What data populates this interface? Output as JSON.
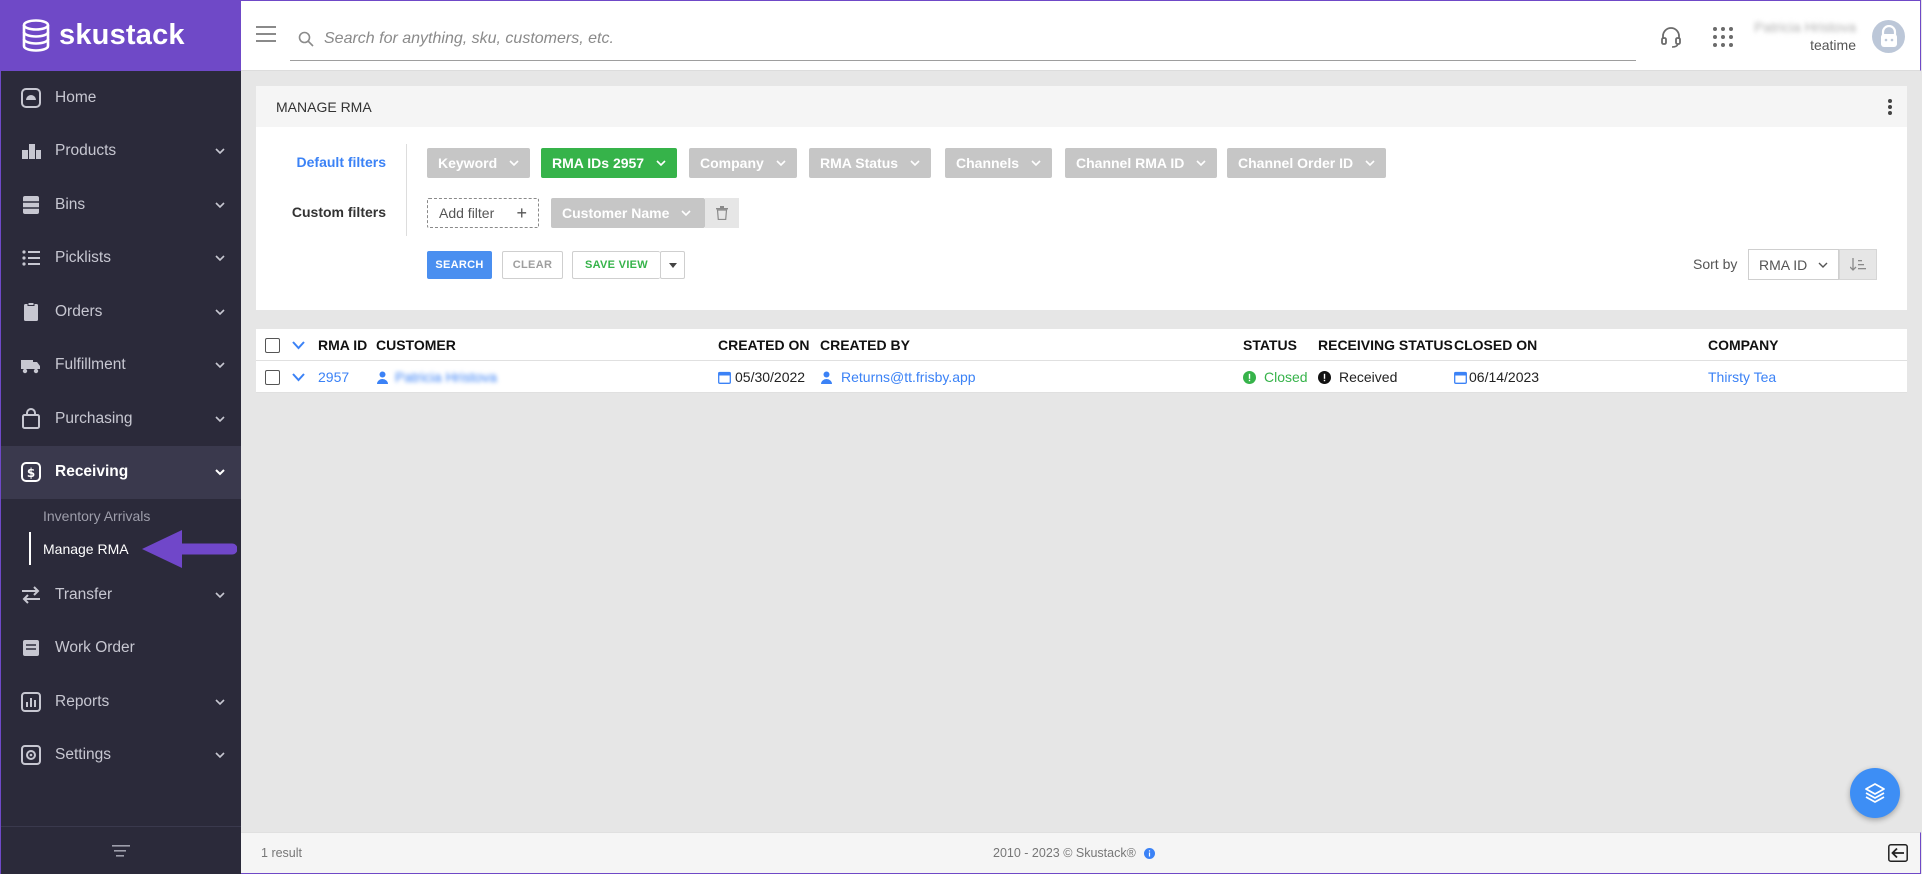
{
  "brand": {
    "name": "skustack"
  },
  "sidebar": {
    "items": [
      {
        "label": "Home",
        "icon": "home-icon"
      },
      {
        "label": "Products",
        "icon": "products-icon"
      },
      {
        "label": "Bins",
        "icon": "bins-icon"
      },
      {
        "label": "Picklists",
        "icon": "picklists-icon"
      },
      {
        "label": "Orders",
        "icon": "orders-icon"
      },
      {
        "label": "Fulfillment",
        "icon": "truck-icon"
      },
      {
        "label": "Purchasing",
        "icon": "bag-icon"
      },
      {
        "label": "Receiving",
        "icon": "dollar-icon"
      },
      {
        "label": "Transfer",
        "icon": "transfer-icon"
      },
      {
        "label": "Work Order",
        "icon": "work-order-icon"
      },
      {
        "label": "Reports",
        "icon": "reports-icon"
      },
      {
        "label": "Settings",
        "icon": "settings-icon"
      }
    ],
    "receiving_sub": [
      {
        "label": "Inventory Arrivals"
      },
      {
        "label": "Manage RMA"
      }
    ]
  },
  "topbar": {
    "search_placeholder": "Search for anything, sku, customers, etc.",
    "user_name": "Patricia Hristova",
    "user_org": "teatime"
  },
  "panel": {
    "title": "MANAGE RMA",
    "default_filters_label": "Default filters",
    "custom_filters_label": "Custom filters",
    "chips": {
      "keyword": "Keyword",
      "rma_ids": "RMA IDs",
      "rma_ids_value": "2957",
      "company": "Company",
      "rma_status": "RMA Status",
      "channels": "Channels",
      "channel_rma_id": "Channel RMA ID",
      "channel_order_id": "Channel Order ID",
      "customer_name": "Customer Name"
    },
    "add_filter": "Add filter",
    "search_btn": "SEARCH",
    "clear_btn": "CLEAR",
    "save_view_btn": "SAVE VIEW",
    "sort_by_label": "Sort by",
    "sort_by_value": "RMA ID"
  },
  "table": {
    "columns": {
      "rma_id": "RMA ID",
      "customer": "CUSTOMER",
      "created_on": "CREATED ON",
      "created_by": "CREATED BY",
      "status": "STATUS",
      "receiving_status": "RECEIVING STATUS",
      "closed_on": "CLOSED ON",
      "company": "COMPANY"
    },
    "rows": [
      {
        "rma_id": "2957",
        "customer": "Patricia Hristova",
        "created_on": "05/30/2022",
        "created_by": "Returns@tt.frisby.app",
        "status": "Closed",
        "receiving_status": "Received",
        "closed_on": "06/14/2023",
        "company": "Thirsty Tea"
      }
    ]
  },
  "footer": {
    "result_count": "1",
    "result_label": "result",
    "copyright": "2010 - 2023 © Skustack®"
  },
  "colors": {
    "brand": "#6f49c7",
    "sidebar_bg": "#2b2a3a",
    "accent_blue": "#3b82f6",
    "green": "#36b34a",
    "chip_gray": "#c6c6c6"
  }
}
